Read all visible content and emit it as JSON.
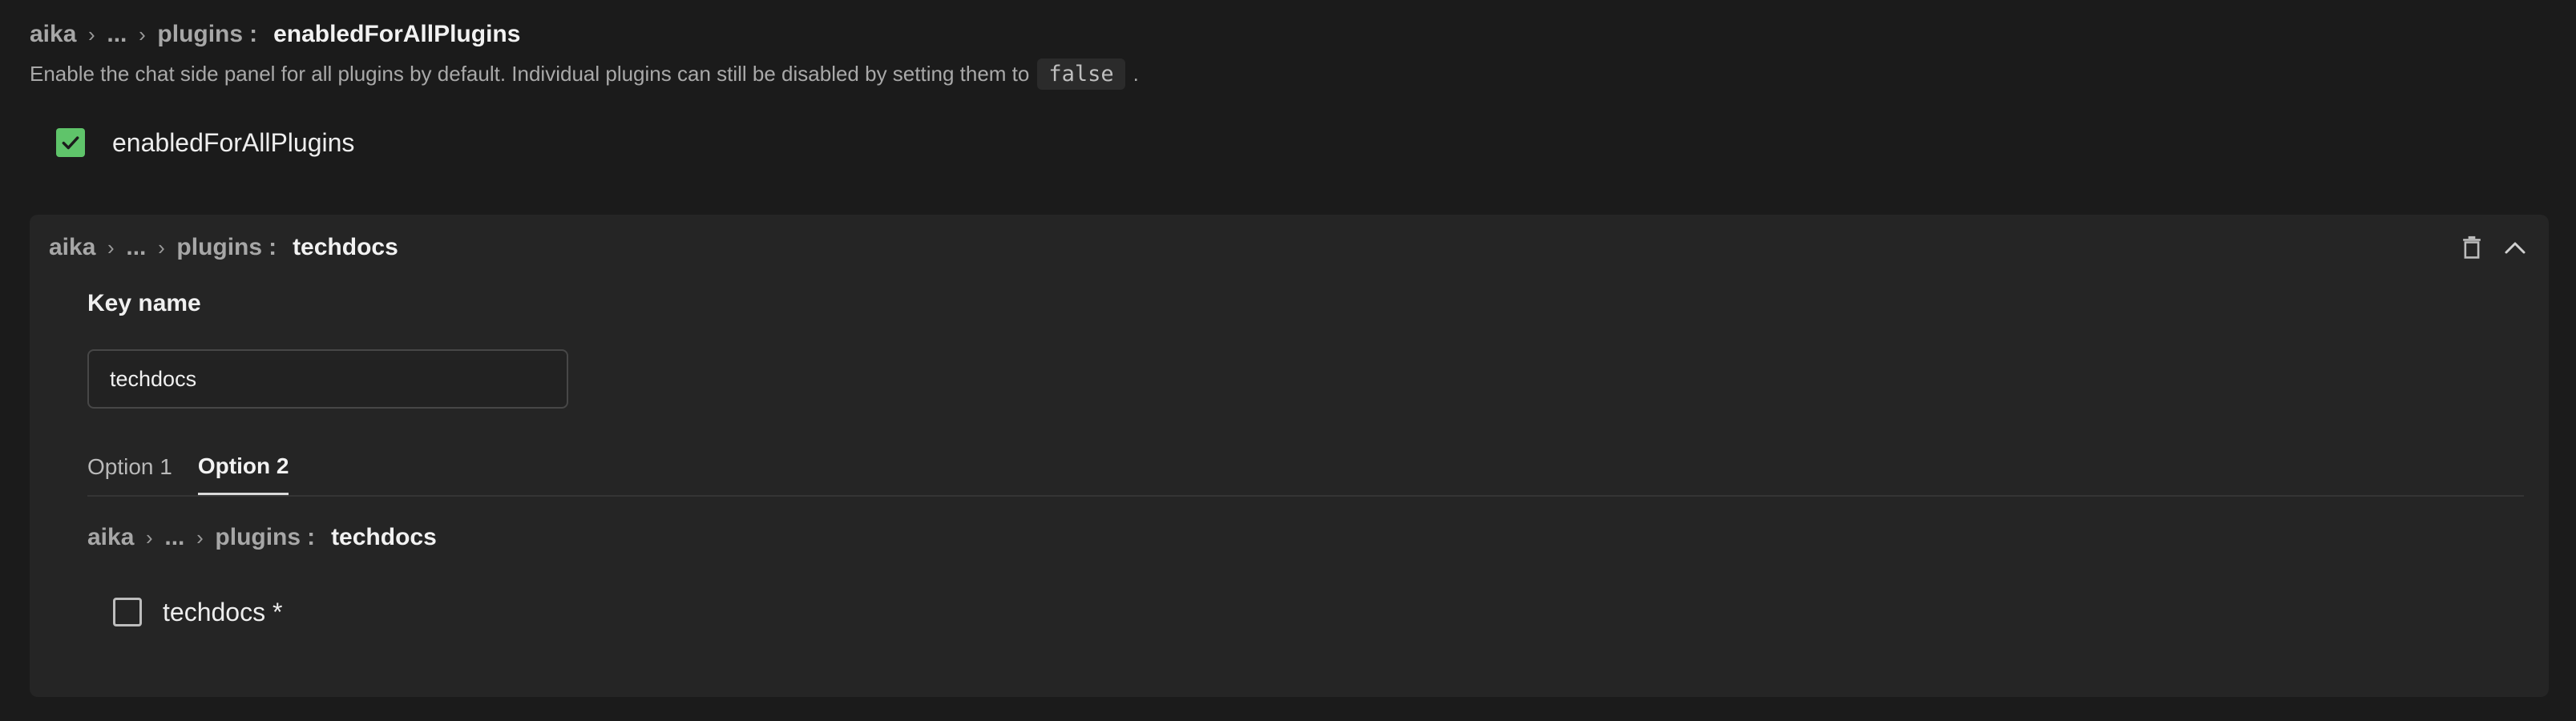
{
  "top": {
    "breadcrumb": {
      "root": "aika",
      "ellipsis": "...",
      "parent": "plugins",
      "colon": ":",
      "current": "enabledForAllPlugins"
    },
    "description": {
      "text_before": "Enable the chat side panel for all plugins by default. Individual plugins can still be disabled by setting them to",
      "code": "false",
      "text_after": "."
    },
    "checkbox": {
      "label": "enabledForAllPlugins",
      "checked": true,
      "color": "#5fc46a"
    }
  },
  "panel": {
    "breadcrumb": {
      "root": "aika",
      "ellipsis": "...",
      "parent": "plugins",
      "colon": ":",
      "current": "techdocs"
    },
    "actions": {
      "delete_icon": "trash-icon",
      "collapse_icon": "chevron-up-icon"
    },
    "key_name_label": "Key name",
    "key_name_value": "techdocs",
    "tabs": [
      {
        "label": "Option 1",
        "active": false
      },
      {
        "label": "Option 2",
        "active": true
      }
    ],
    "inner_breadcrumb": {
      "root": "aika",
      "ellipsis": "...",
      "parent": "plugins",
      "colon": ":",
      "current": "techdocs"
    },
    "inner_checkbox": {
      "label": "techdocs *",
      "checked": false
    }
  }
}
